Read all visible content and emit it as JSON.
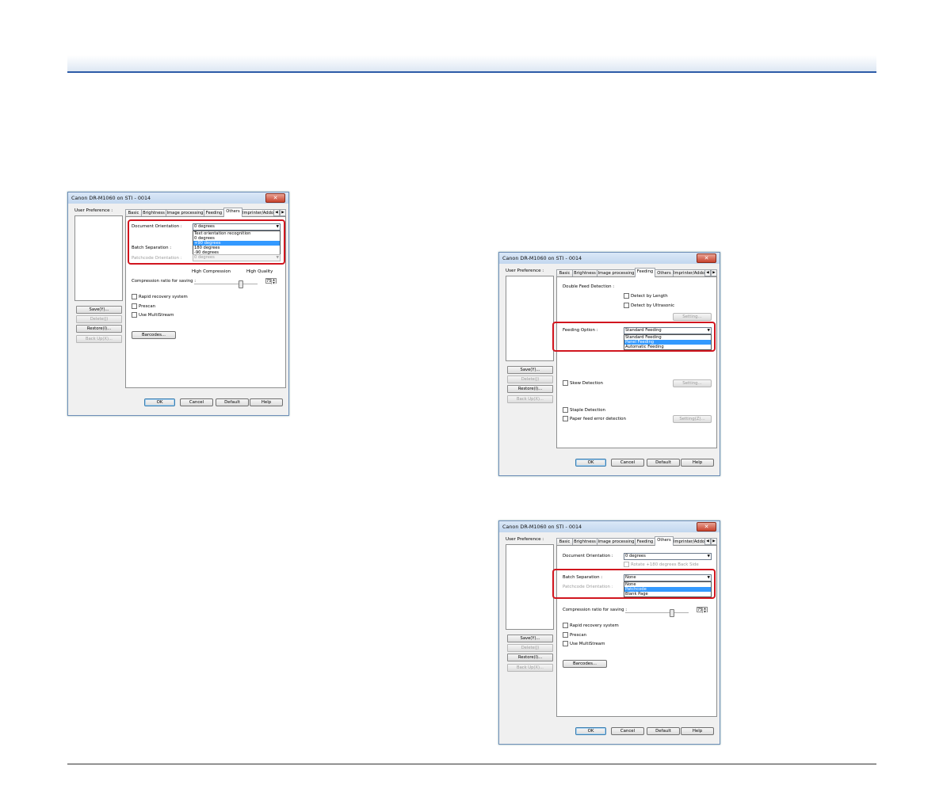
{
  "dialog_a": {
    "title": "Canon DR-M1060 on STI - 0014",
    "user_preference_label": "User Preference :",
    "side_buttons": [
      "Save(Y)...",
      "Delete(J)",
      "Restore(I)...",
      "Back Up(X)..."
    ],
    "tabs": [
      "Basic",
      "Brightness",
      "Image processing",
      "Feeding",
      "Others",
      "Imprinter/Addo"
    ],
    "selected_tab": "Others",
    "document_orientation_label": "Document Orientation :",
    "document_orientation_value": "0 degrees",
    "document_orientation_options": [
      "Text orientation recognition",
      "0 degrees",
      "+90 degrees",
      "180 degrees",
      "-90 degrees"
    ],
    "document_orientation_highlighted": "+90 degrees",
    "batch_separation_label": "Batch Separation :",
    "patchcode_orientation_label": "Patchcode Orientation :",
    "patchcode_orientation_value": "0 degrees",
    "high_compression_label": "High Compression",
    "high_quality_label": "High Quality",
    "compression_label": "Compression ratio for saving :",
    "compression_value": "75",
    "checkboxes": [
      "Rapid recovery system",
      "Prescan",
      "Use MultiStream"
    ],
    "barcodes_button": "Barcodes...",
    "bottom_buttons": [
      "OK",
      "Cancel",
      "Default",
      "Help"
    ]
  },
  "dialog_b": {
    "title": "Canon DR-M1060 on STI - 0014",
    "user_preference_label": "User Preference :",
    "side_buttons": [
      "Save(Y)...",
      "Delete(J)",
      "Restore(I)...",
      "Back Up(X)..."
    ],
    "tabs": [
      "Basic",
      "Brightness",
      "Image processing",
      "Feeding",
      "Others",
      "Imprinter/Addo"
    ],
    "selected_tab": "Feeding",
    "double_feed_label": "Double Feed Detection :",
    "detect_by_length": "Detect by Length",
    "detect_by_ultrasonic": "Detect by Ultrasonic",
    "setting_button": "Setting...",
    "feeding_option_label": "Feeding Option :",
    "feeding_option_value": "Standard Feeding",
    "feeding_options": [
      "Standard Feeding",
      "Panel Feeding",
      "Automatic Feeding"
    ],
    "feeding_highlighted": "Panel Feeding",
    "skew_detection": "Skew Detection",
    "skew_setting_button": "Setting...",
    "staple_detection": "Staple Detection",
    "paper_feed_error": "Paper feed error detection",
    "paper_feed_setting_button": "Setting(Z)...",
    "bottom_buttons": [
      "OK",
      "Cancel",
      "Default",
      "Help"
    ]
  },
  "dialog_c": {
    "title": "Canon DR-M1060 on STI - 0014",
    "user_preference_label": "User Preference :",
    "side_buttons": [
      "Save(Y)...",
      "Delete(J)",
      "Restore(I)...",
      "Back Up(X)..."
    ],
    "tabs": [
      "Basic",
      "Brightness",
      "Image processing",
      "Feeding",
      "Others",
      "Imprinter/Addo"
    ],
    "selected_tab": "Others",
    "document_orientation_label": "Document Orientation :",
    "document_orientation_value": "0 degrees",
    "rotate_label": "Rotate +180 degrees Back Side",
    "batch_separation_label": "Batch Separation :",
    "batch_separation_value": "None",
    "batch_options": [
      "None",
      "Patchcode",
      "Blank Page"
    ],
    "batch_highlighted": "Patchcode",
    "patchcode_orientation_label": "Patchcode Orientation :",
    "compression_label": "Compression ratio for saving :",
    "compression_value": "75",
    "checkboxes": [
      "Rapid recovery system",
      "Prescan",
      "Use MultiStream"
    ],
    "barcodes_button": "Barcodes...",
    "bottom_buttons": [
      "OK",
      "Cancel",
      "Default",
      "Help"
    ]
  },
  "colors": {
    "header_rule": "#2e5ca8",
    "callout": "#d1161f",
    "selection": "#3399ff"
  }
}
